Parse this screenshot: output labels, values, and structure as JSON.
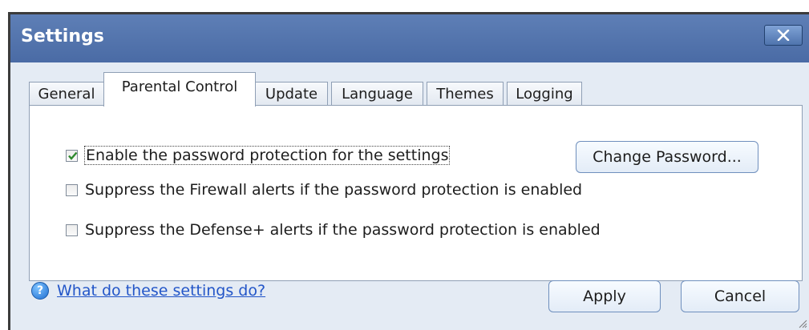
{
  "window": {
    "title": "Settings"
  },
  "tabs": [
    {
      "label": "General",
      "active": false
    },
    {
      "label": "Parental Control",
      "active": true
    },
    {
      "label": "Update",
      "active": false
    },
    {
      "label": "Language",
      "active": false
    },
    {
      "label": "Themes",
      "active": false
    },
    {
      "label": "Logging",
      "active": false
    }
  ],
  "options": [
    {
      "label": "Enable the password protection for the settings",
      "checked": true
    },
    {
      "label": "Suppress the Firewall alerts if the password protection is enabled",
      "checked": false
    },
    {
      "label": "Suppress the Defense+ alerts if the password protection is enabled",
      "checked": false
    }
  ],
  "buttons": {
    "change_password": "Change  Password...",
    "apply": "Apply",
    "cancel": "Cancel"
  },
  "help": {
    "link": "What do these settings do?",
    "icon": "?"
  },
  "icons": {
    "close": "close-icon",
    "help": "help-icon",
    "check": "checkmark-icon",
    "grip": "resize-grip-icon"
  }
}
